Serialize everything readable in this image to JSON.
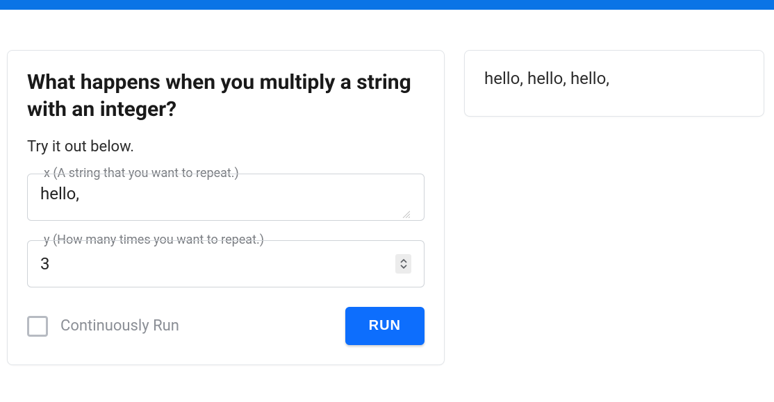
{
  "header": {
    "accent_color": "#0a74e6"
  },
  "left": {
    "title": "What happens when you multiply a string with an integer?",
    "subtitle": "Try it out below.",
    "fields": {
      "x": {
        "label": "x (A string that you want to repeat.)",
        "value": "hello, "
      },
      "y": {
        "label": "y (How many times you want to repeat.)",
        "value": "3"
      }
    },
    "continuous": {
      "label": "Continuously Run",
      "checked": false
    },
    "run_label": "RUN"
  },
  "right": {
    "output": "hello, hello, hello, "
  }
}
